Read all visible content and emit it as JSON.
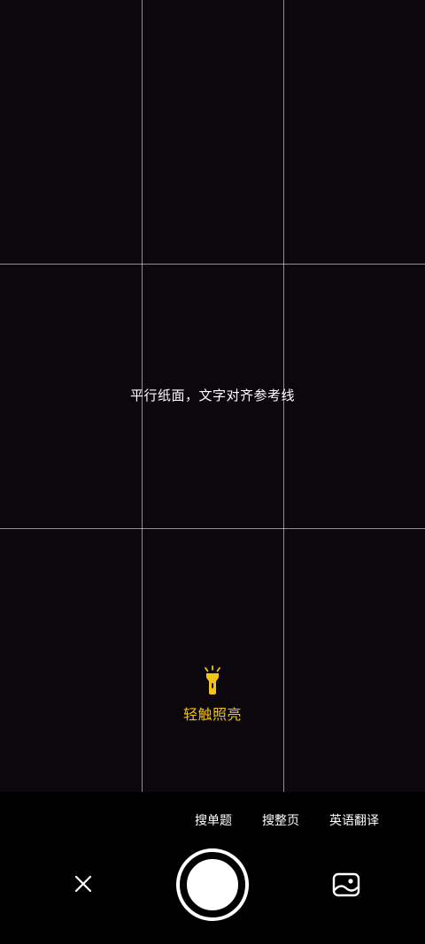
{
  "viewfinder": {
    "hint": "平行纸面，文字对齐参考线",
    "torch_label": "轻触照亮"
  },
  "modes": [
    {
      "label": "搜单题"
    },
    {
      "label": "搜整页"
    },
    {
      "label": "英语翻译"
    }
  ],
  "icons": {
    "torch": "flashlight-icon",
    "close": "close-icon",
    "gallery": "image-gallery-icon"
  },
  "colors": {
    "viewfinder_bg": "#0b070c",
    "accent": "#f3c316",
    "text": "#ffffff"
  }
}
